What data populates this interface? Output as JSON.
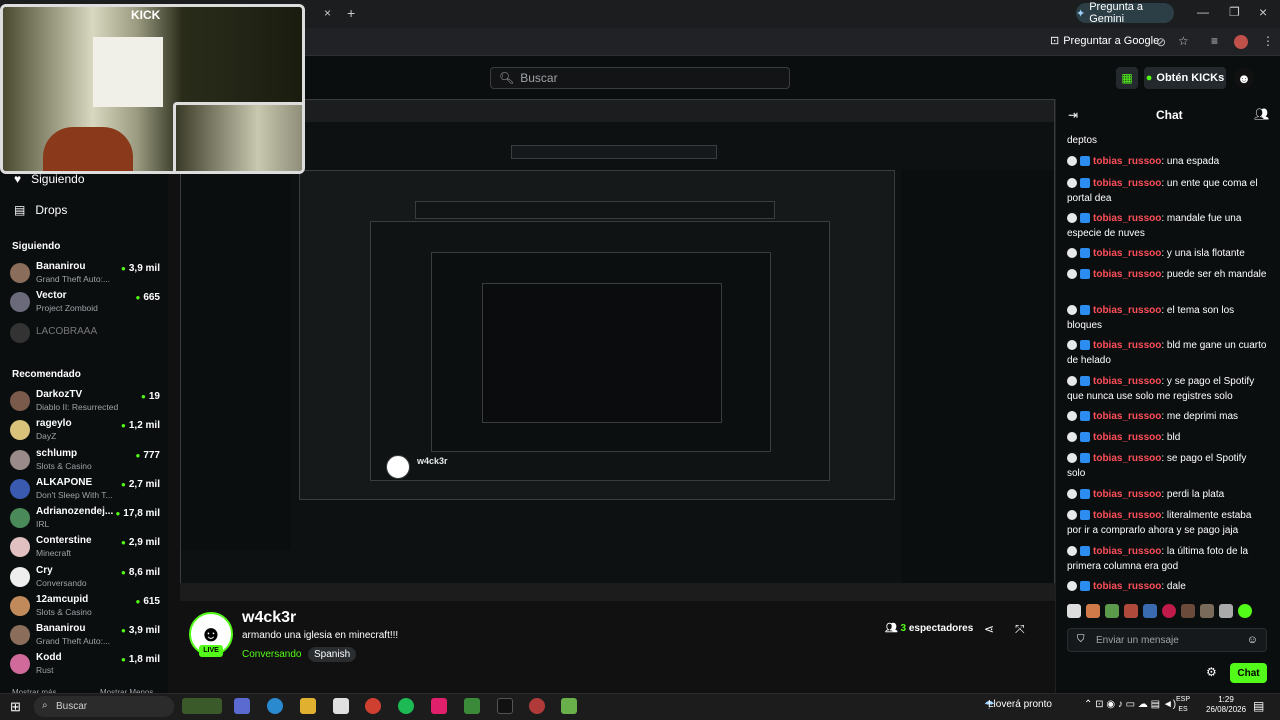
{
  "browser": {
    "gemini_label": "Pregunta a Gemini",
    "google_label": "Preguntar a Google",
    "tab_close": "×",
    "tab_new": "+"
  },
  "header": {
    "search_placeholder": "Buscar",
    "kicks_label": "Obtén KICKs"
  },
  "webcam": {
    "logo": "KICK"
  },
  "sidebar": {
    "nav_following": "Siguiendo",
    "nav_drops": "Drops",
    "section_following": "Siguiendo",
    "following": [
      {
        "name": "Bananirou",
        "game": "Grand Theft Auto:...",
        "viewers": "3,9 mil",
        "color": "#8a6d5a"
      },
      {
        "name": "Vector",
        "game": "Project Zomboid",
        "viewers": "665",
        "color": "#6a6a7a"
      },
      {
        "name": "LACOBRAAA",
        "game": "",
        "viewers": "",
        "color": "#444"
      }
    ],
    "section_recommended": "Recomendado",
    "recommended": [
      {
        "name": "DarkozTV",
        "game": "Diablo II: Resurrected",
        "viewers": "19",
        "color": "#7a5a4a"
      },
      {
        "name": "rageylo",
        "game": "DayZ",
        "viewers": "1,2 mil",
        "color": "#d9c27a"
      },
      {
        "name": "schlump",
        "game": "Slots & Casino",
        "viewers": "777",
        "color": "#9a8a8a"
      },
      {
        "name": "ALKAPONE",
        "game": "Don't Sleep With T...",
        "viewers": "2,7 mil",
        "color": "#3a5ab0"
      },
      {
        "name": "Adrianozendej...",
        "game": "IRL",
        "viewers": "17,8 mil",
        "color": "#4a8a5a"
      },
      {
        "name": "Conterstine",
        "game": "Minecraft",
        "viewers": "2,9 mil",
        "color": "#e0c0c0"
      },
      {
        "name": "Cry",
        "game": "Conversando",
        "viewers": "8,6 mil",
        "color": "#eeeeee"
      },
      {
        "name": "12amcupid",
        "game": "Slots & Casino",
        "viewers": "615",
        "color": "#c08a5a"
      },
      {
        "name": "Bananirou",
        "game": "Grand Theft Auto:...",
        "viewers": "3,9 mil",
        "color": "#8a6d5a"
      },
      {
        "name": "Kodd",
        "game": "Rust",
        "viewers": "1,8 mil",
        "color": "#d06a9a"
      }
    ],
    "footer_left": "Mostrar más",
    "footer_right": "Mostrar Menos"
  },
  "stream": {
    "streamer": "w4ck3r",
    "title": "armando una iglesia en minecraft!!!",
    "category": "Conversando",
    "language": "Spanish",
    "viewers_count": "3",
    "viewers_label": "espectadores",
    "live": "LIVE"
  },
  "chat": {
    "title": "Chat",
    "input_placeholder": "Enviar un mensaje",
    "send_label": "Chat",
    "top_fragment": "deptos",
    "messages": [
      {
        "user": "tobias_russoo",
        "text": "una espada"
      },
      {
        "user": "tobias_russoo",
        "text": "un ente que coma el portal dea"
      },
      {
        "user": "tobias_russoo",
        "text": "mandale fue una especie de nuves"
      },
      {
        "user": "tobias_russoo",
        "text": "y una isla flotante"
      },
      {
        "user": "tobias_russoo",
        "text": "puede ser eh mandale"
      },
      {
        "user": "tobias_russoo",
        "text": "el tema son los bloques"
      },
      {
        "user": "tobias_russoo",
        "text": "bld me gane un cuarto de helado"
      },
      {
        "user": "tobias_russoo",
        "text": "y se pago el Spotify que nunca use solo me registres solo"
      },
      {
        "user": "tobias_russoo",
        "text": "me deprimi mas"
      },
      {
        "user": "tobias_russoo",
        "text": "bld"
      },
      {
        "user": "tobias_russoo",
        "text": "se pago el Spotify solo"
      },
      {
        "user": "tobias_russoo",
        "text": "perdi la plata"
      },
      {
        "user": "tobias_russoo",
        "text": "literalmente estaba por ir a comprarlo ahora y se pago jaja"
      },
      {
        "user": "tobias_russoo",
        "text": "la última foto de la primera columna era god"
      },
      {
        "user": "tobias_russoo",
        "text": "dale"
      }
    ]
  },
  "taskbar": {
    "search": "Buscar",
    "weather": "Lloverá pronto",
    "lang_top": "ESP",
    "lang_bottom": "ES",
    "time": "1:29",
    "date": "26/08/2026"
  }
}
